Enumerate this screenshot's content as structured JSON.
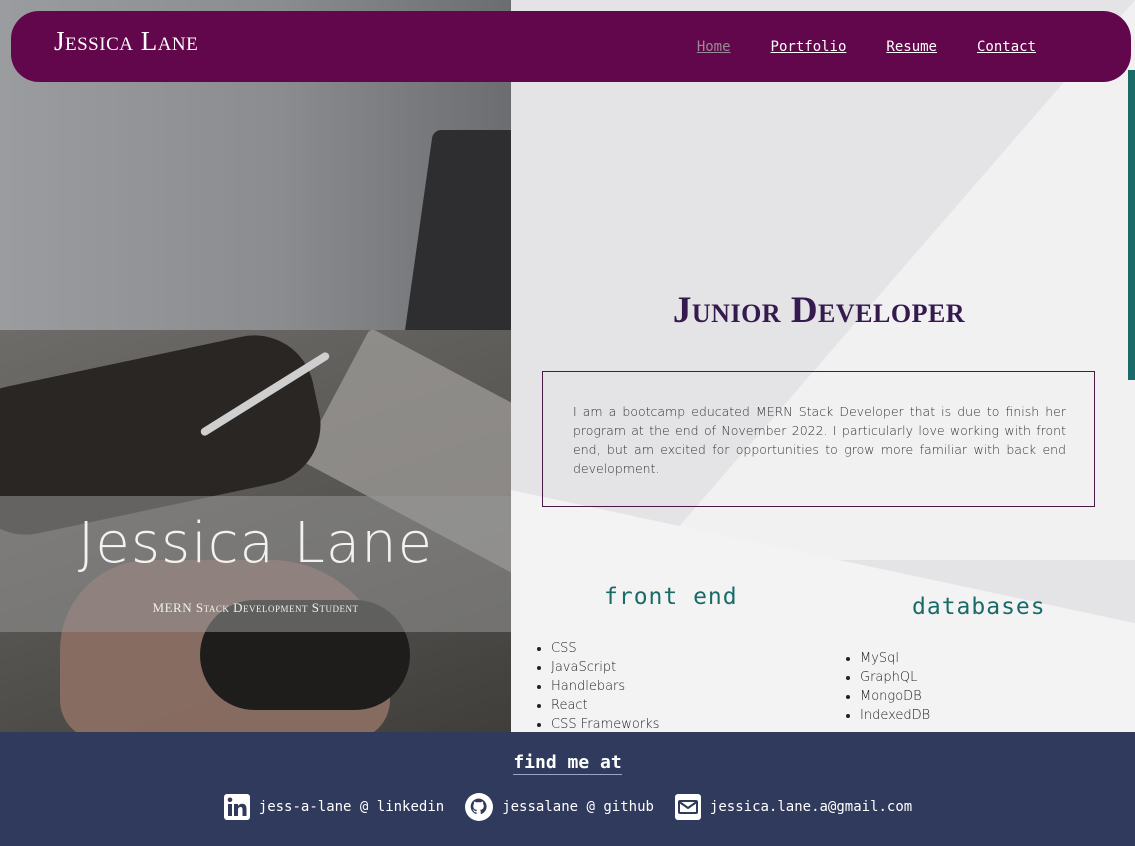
{
  "header": {
    "brand": "Jessica Lane",
    "nav": [
      {
        "label": "Home",
        "active": true
      },
      {
        "label": "Portfolio",
        "active": false
      },
      {
        "label": "Resume",
        "active": false
      },
      {
        "label": "Contact",
        "active": false
      }
    ]
  },
  "hero": {
    "name": "Jessica Lane",
    "tagline": "MERN Stack Development Student"
  },
  "main": {
    "title": "Junior Developer",
    "bio": "I am a bootcamp educated MERN Stack Developer that is due to finish her program at the end of November 2022. I particularly love working with front end, but am excited for opportunities to grow more familiar with back end development."
  },
  "skills": {
    "front_end": {
      "title": "front end",
      "items": [
        "CSS",
        "JavaScript",
        "Handlebars",
        "React",
        "CSS Frameworks"
      ]
    },
    "databases": {
      "title": "databases",
      "items": [
        "MySql",
        "GraphQL",
        "MongoDB",
        "IndexedDB"
      ]
    }
  },
  "footer": {
    "title": "find me at",
    "contacts": [
      {
        "icon": "linkedin-icon",
        "label": "jess-a-lane @ linkedin"
      },
      {
        "icon": "github-icon",
        "label": "jessalane @ github"
      },
      {
        "icon": "envelope-icon",
        "label": "jessica.lane.a@gmail.com"
      }
    ]
  },
  "colors": {
    "header_bg": "#62074b",
    "title": "#341a4f",
    "accent_teal": "#1a6b68",
    "footer_bg": "#2f3a5c"
  }
}
